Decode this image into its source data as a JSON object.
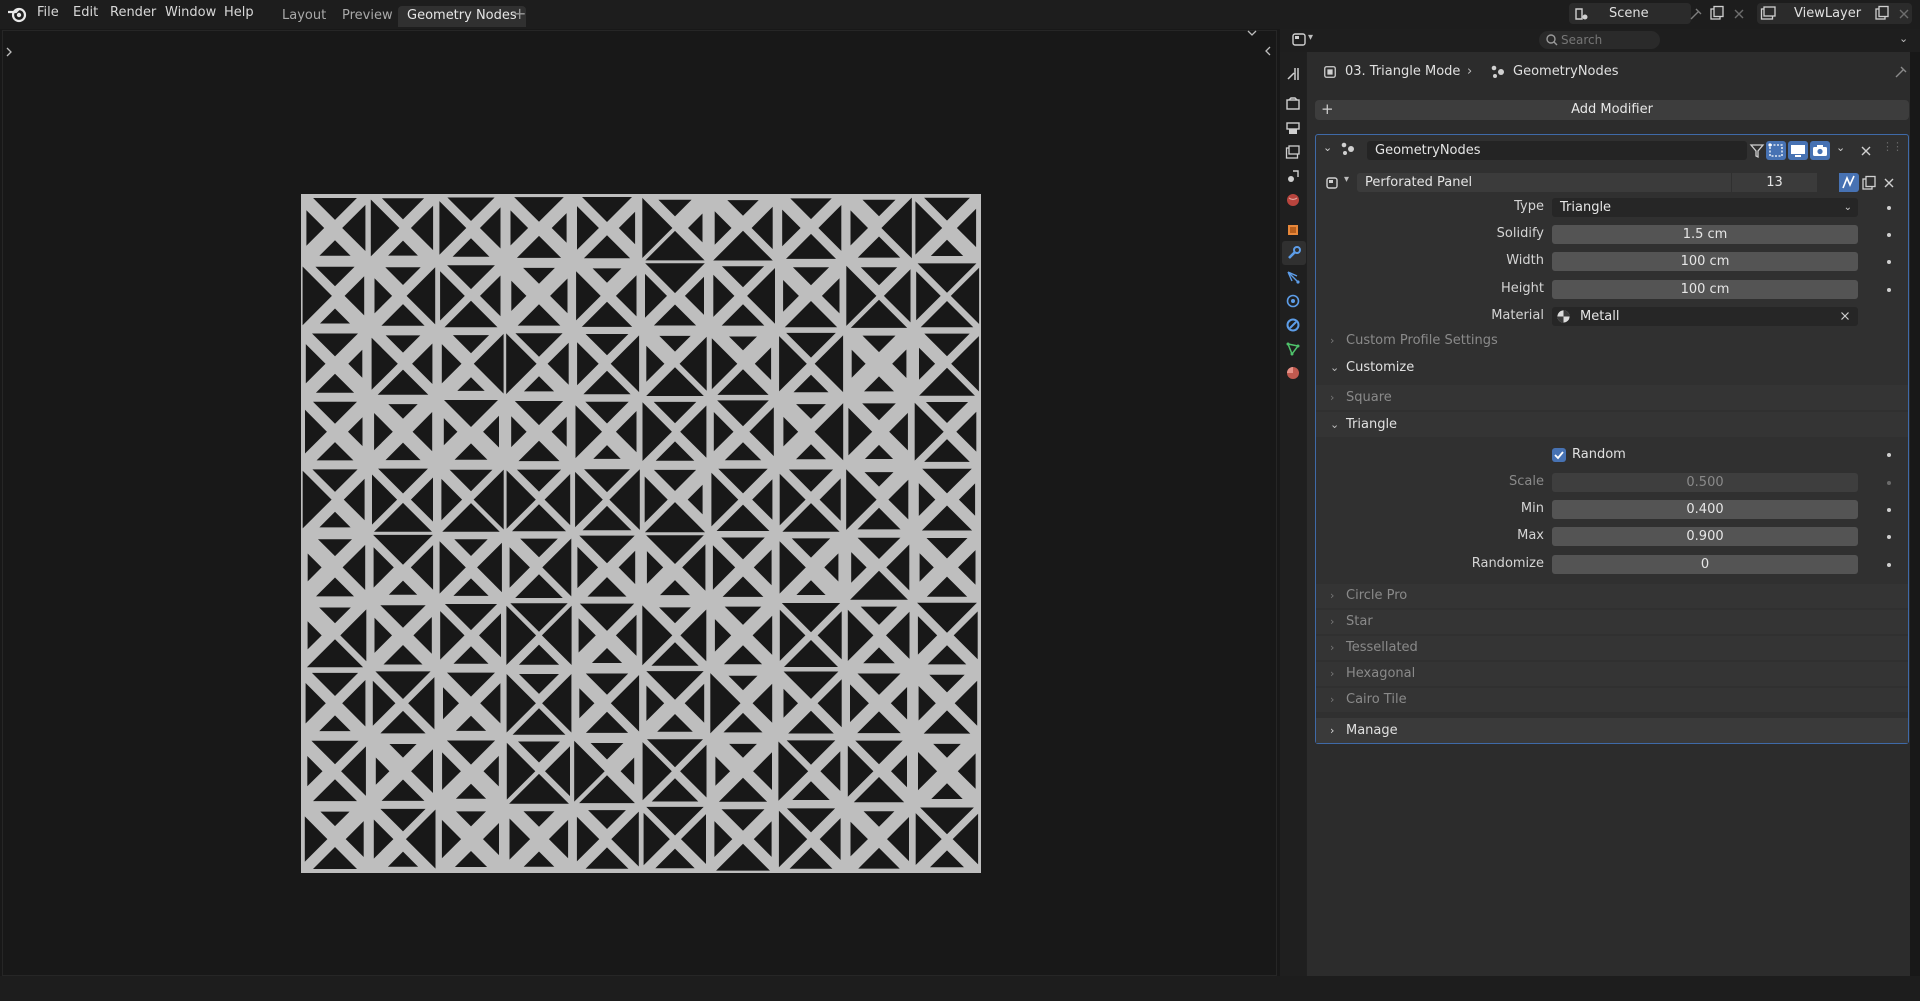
{
  "topbar": {
    "menus": [
      "File",
      "Edit",
      "Render",
      "Window",
      "Help"
    ],
    "workspaces": [
      "Layout",
      "Preview",
      "Geometry Nodes"
    ],
    "active_workspace": "Geometry Nodes",
    "scene": "Scene",
    "view_layer": "ViewLayer"
  },
  "props": {
    "search_placeholder": "Search",
    "breadcrumb": {
      "object": "03. Triangle Mode",
      "modifier": "GeometryNodes"
    },
    "add_modifier": "Add Modifier",
    "modifier": {
      "name": "GeometryNodes",
      "node_group": "Perforated Panel",
      "users": "13"
    },
    "fields": {
      "type": {
        "label": "Type",
        "value": "Triangle"
      },
      "solidify": {
        "label": "Solidify",
        "value": "1.5 cm"
      },
      "width": {
        "label": "Width",
        "value": "100 cm"
      },
      "height": {
        "label": "Height",
        "value": "100 cm"
      },
      "material": {
        "label": "Material",
        "value": "Metall"
      }
    },
    "sections": {
      "custom_profile": "Custom Profile Settings",
      "customize": "Customize",
      "square": "Square",
      "triangle": "Triangle",
      "circle_pro": "Circle Pro",
      "star": "Star",
      "tessellated": "Tessellated",
      "hexagonal": "Hexagonal",
      "cairo_tile": "Cairo Tile",
      "manage": "Manage"
    },
    "triangle": {
      "random": {
        "label": "Random",
        "checked": true
      },
      "scale": {
        "label": "Scale",
        "value": "0.500"
      },
      "min": {
        "label": "Min",
        "value": "0.400"
      },
      "max": {
        "label": "Max",
        "value": "0.900"
      },
      "randomize": {
        "label": "Randomize",
        "value": "0"
      }
    }
  },
  "colors": {
    "accent": "#4772b3",
    "panel": "#bebebe",
    "holes": "#181818"
  }
}
